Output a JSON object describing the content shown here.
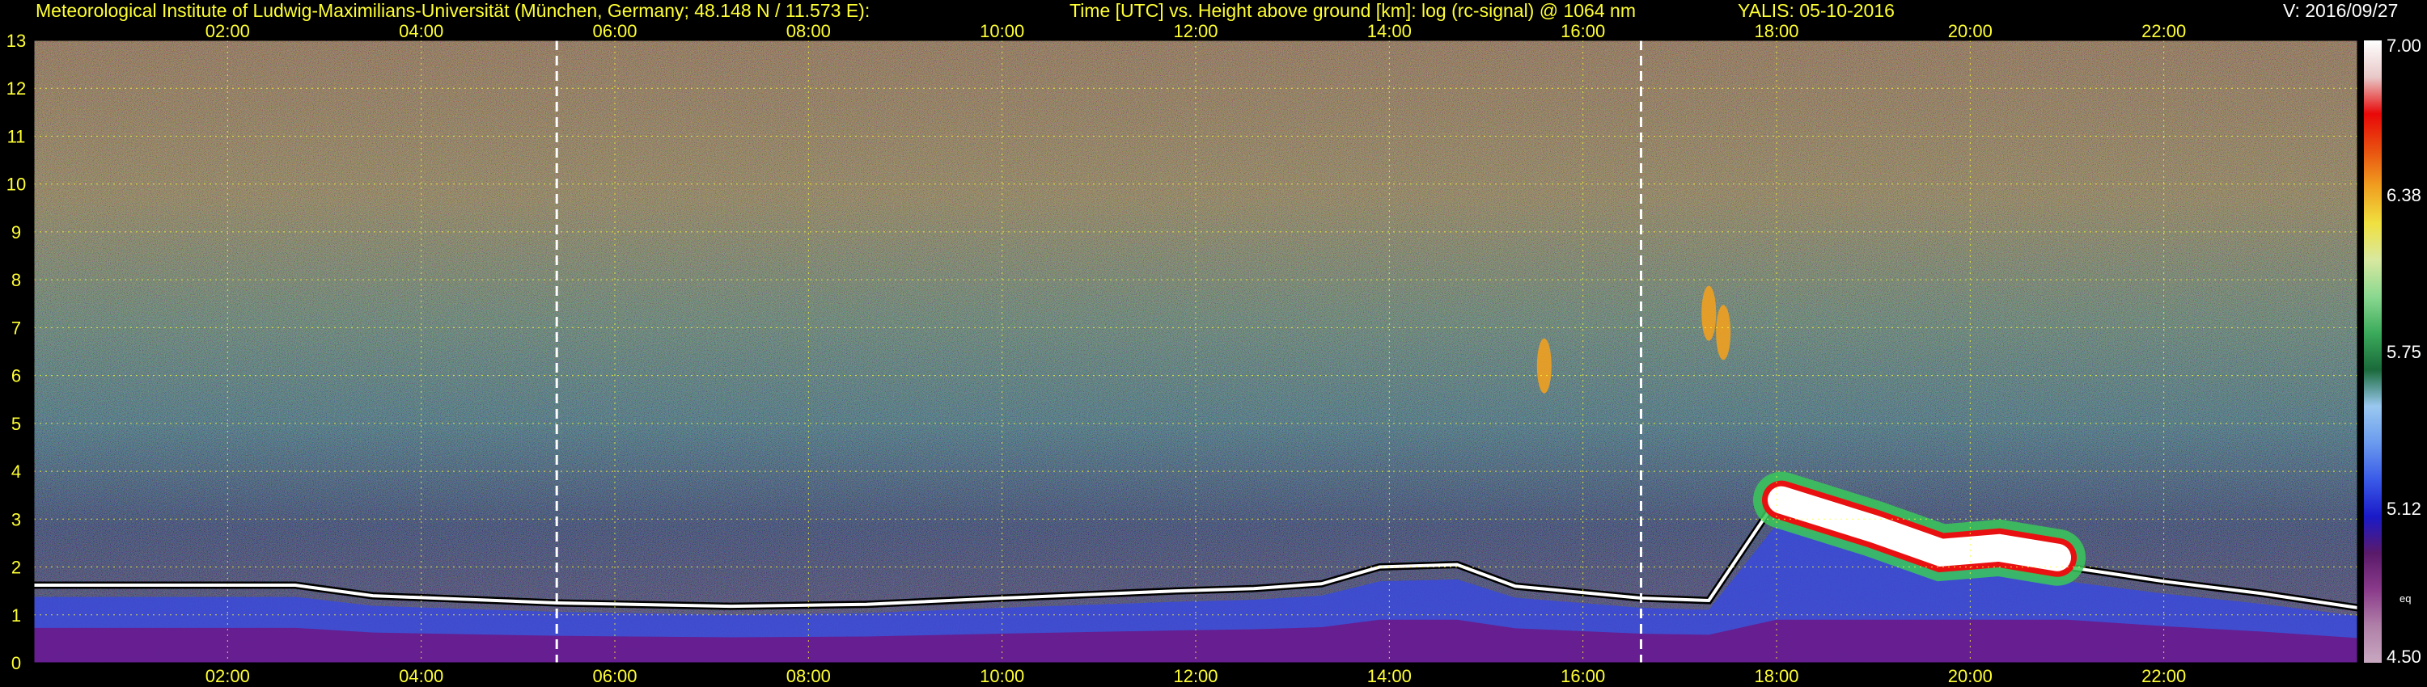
{
  "header": {
    "institute": "Meteorological Institute of Ludwig-Maximilians-Universität (München, Germany; 48.148 N / 11.573 E):",
    "description": "Time [UTC] vs. Height above ground [km]: log (rc-signal) @ 1064 nm",
    "instrument": "YALIS: 05-10-2016",
    "version": "V: 2016/09/27"
  },
  "chart_data": {
    "type": "heatmap",
    "title": "Time [UTC] vs. Height above ground [km]: log (rc-signal) @ 1064 nm",
    "x_axis": {
      "label": "Time [UTC]",
      "range_hours": [
        0,
        24
      ],
      "ticks": [
        "02:00",
        "04:00",
        "06:00",
        "08:00",
        "10:00",
        "12:00",
        "14:00",
        "16:00",
        "18:00",
        "20:00",
        "22:00"
      ],
      "tick_hours": [
        2,
        4,
        6,
        8,
        10,
        12,
        14,
        16,
        18,
        20,
        22
      ]
    },
    "y_axis": {
      "label": "Height above ground [km]",
      "range_km": [
        0,
        13
      ],
      "ticks": [
        "0",
        "1",
        "2",
        "3",
        "4",
        "5",
        "6",
        "7",
        "8",
        "9",
        "10",
        "11",
        "12",
        "13"
      ]
    },
    "grid": true,
    "colorbar": {
      "range": [
        4.5,
        7.0
      ],
      "ticks": [
        "4.50",
        "5.12",
        "5.75",
        "6.38",
        "7.00"
      ],
      "note": "eq",
      "colors": [
        "#c8a8c0",
        "#b080a8",
        "#8a3a8a",
        "#5a1a6a",
        "#1a1ac8",
        "#3a5ae8",
        "#6a9aee",
        "#9ac8f0",
        "#1a6a3a",
        "#3aaa5a",
        "#8ad890",
        "#d8e8a0",
        "#f0e040",
        "#f0a020",
        "#e85010",
        "#e80808",
        "#e8c8c8",
        "#ffffff"
      ]
    },
    "markers_hours": [
      5.4,
      16.6
    ],
    "features": {
      "boundary_layer_top_km": [
        [
          0.0,
          1.62
        ],
        [
          2.7,
          1.62
        ],
        [
          3.5,
          1.4
        ],
        [
          5.4,
          1.25
        ],
        [
          7.2,
          1.18
        ],
        [
          8.6,
          1.22
        ],
        [
          10.0,
          1.35
        ],
        [
          11.8,
          1.5
        ],
        [
          12.6,
          1.55
        ],
        [
          13.3,
          1.65
        ],
        [
          13.9,
          2.0
        ],
        [
          14.7,
          2.05
        ],
        [
          15.3,
          1.6
        ],
        [
          16.6,
          1.35
        ],
        [
          17.3,
          1.3
        ],
        [
          18.0,
          3.4
        ],
        [
          19.4,
          2.65
        ],
        [
          21.0,
          2.0
        ],
        [
          22.0,
          1.7
        ],
        [
          23.0,
          1.45
        ],
        [
          24.0,
          1.15
        ]
      ],
      "cloud_core_km": [
        [
          18.05,
          3.4
        ],
        [
          19.0,
          2.8
        ],
        [
          19.7,
          2.3
        ],
        [
          20.3,
          2.4
        ],
        [
          20.9,
          2.2
        ]
      ],
      "cirrus_km": [
        [
          17.3,
          7.3
        ],
        [
          17.45,
          6.9
        ],
        [
          15.6,
          6.2
        ]
      ]
    }
  }
}
